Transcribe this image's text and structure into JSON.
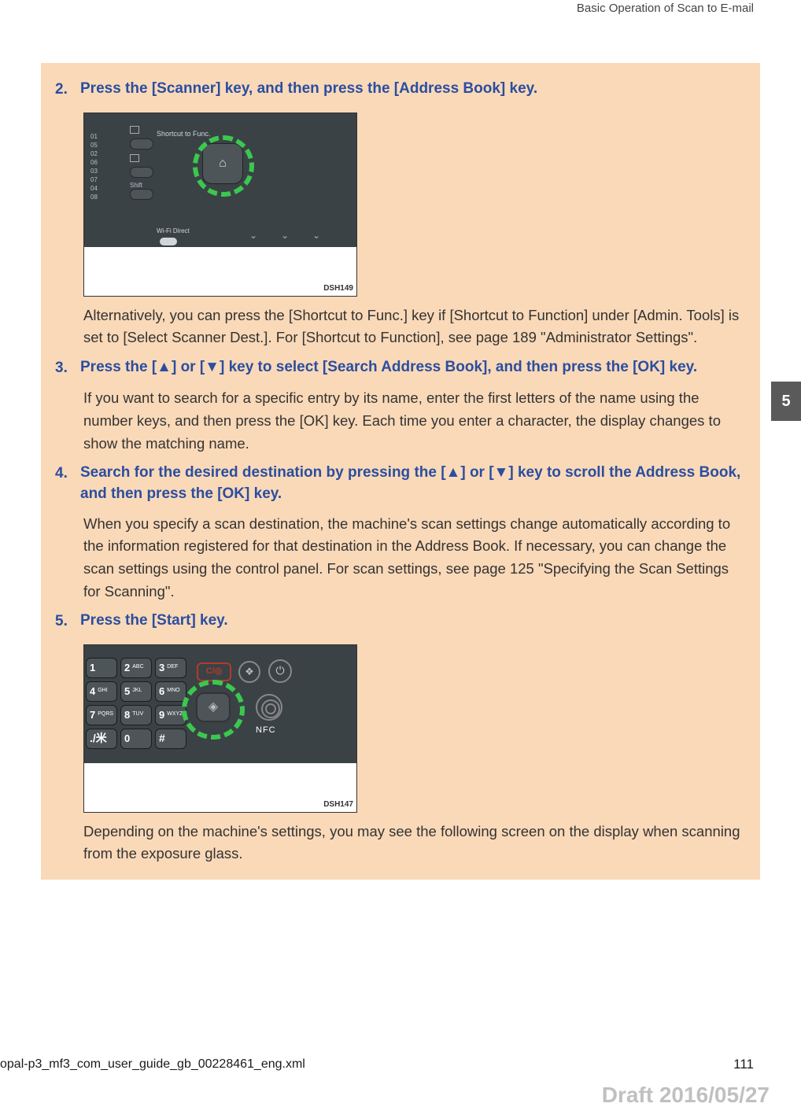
{
  "header": {
    "title": "Basic Operation of Scan to E-mail"
  },
  "sideTab": {
    "chapter": "5"
  },
  "steps": {
    "s2": {
      "num": "2.",
      "title": "Press the [Scanner] key, and then press the [Address Book] key.",
      "figure_label": "DSH149",
      "body": "Alternatively, you can press the [Shortcut to Func.] key if [Shortcut to Function] under [Admin. Tools] is set to [Select Scanner Dest.]. For [Shortcut to Function], see page 189 \"Administrator Settings\"."
    },
    "s3": {
      "num": "3.",
      "title": "Press the [▲] or [▼] key to select [Search Address Book], and then press the [OK] key.",
      "body": "If you want to search for a specific entry by its name, enter the first letters of the name using the number keys, and then press the [OK] key. Each time you enter a character, the display changes to show the matching name."
    },
    "s4": {
      "num": "4.",
      "title": "Search for the desired destination by pressing the [▲] or [▼] key to scroll the Address Book, and then press the [OK] key.",
      "body": "When you specify a scan destination, the machine's scan settings change automatically according to the information registered for that destination in the Address Book. If necessary, you can change the scan settings using the control panel. For scan settings, see page 125 \"Specifying the Scan Settings for Scanning\"."
    },
    "s5": {
      "num": "5.",
      "title": "Press the [Start] key.",
      "figure_label": "DSH147",
      "body": "Depending on the machine's settings, you may see the following screen on the display when scanning from the exposure glass."
    }
  },
  "figure1": {
    "shortcut_label": "Shortcut to Func.",
    "wifi_label": "Wi-Fi Direct",
    "shift_label": "Shift",
    "address_icon": "⌂",
    "left_numbers": [
      "01",
      "05",
      "02",
      "06",
      "03",
      "07",
      "04",
      "08"
    ]
  },
  "figure2": {
    "keys": [
      {
        "n": "1",
        "l": ""
      },
      {
        "n": "2",
        "l": "ABC"
      },
      {
        "n": "3",
        "l": "DEF"
      },
      {
        "n": "4",
        "l": "GHI"
      },
      {
        "n": "5",
        "l": "JKL"
      },
      {
        "n": "6",
        "l": "MNO"
      },
      {
        "n": "7",
        "l": "PQRS"
      },
      {
        "n": "8",
        "l": "TUV"
      },
      {
        "n": "9",
        "l": "WXYZ"
      },
      {
        "n": "./米",
        "l": ""
      },
      {
        "n": "0",
        "l": ""
      },
      {
        "n": "#",
        "l": ""
      }
    ],
    "clear_label": "C/◎",
    "nfc_label": "NFC",
    "start_icon": "◈",
    "copy_icon": "❖",
    "power_icon": "⏻"
  },
  "footer": {
    "file": "opal-p3_mf3_com_user_guide_gb_00228461_eng.xml",
    "page": "111",
    "draft": "Draft 2016/05/27"
  }
}
